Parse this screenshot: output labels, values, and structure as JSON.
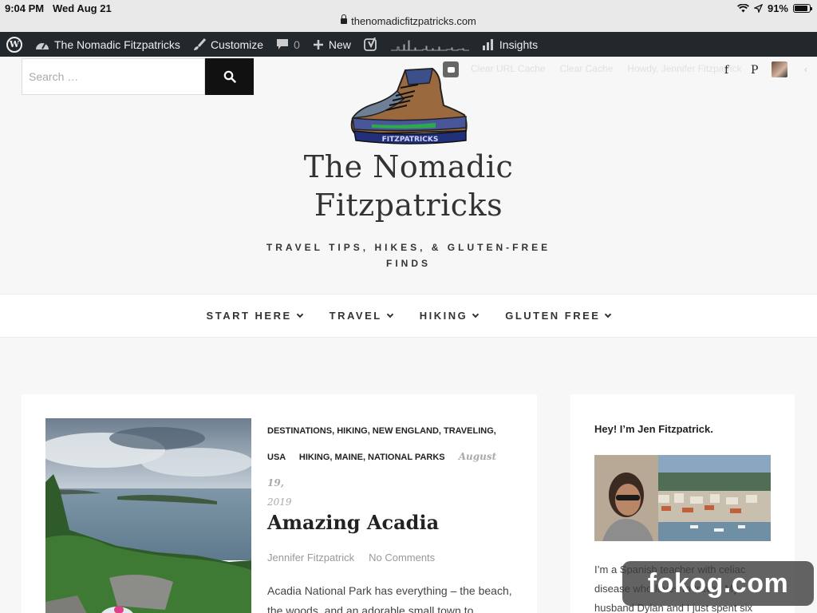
{
  "status_bar": {
    "time": "9:04 PM",
    "date": "Wed Aug 21",
    "url": "thenomadicfitzpatricks.com",
    "battery": "91%",
    "battery_level": 0.91
  },
  "admin_bar": {
    "site_name": "The Nomadic Fitzpatricks",
    "customize": "Customize",
    "comments_count": "0",
    "new": "New",
    "insights": "Insights"
  },
  "header": {
    "search_placeholder": "Search …",
    "ghost_links": [
      "Clear URL Cache",
      "Clear Cache",
      "Howdy, Jennifer Fitzpatrick"
    ],
    "social": {
      "facebook": "f",
      "pinterest": "P"
    },
    "logo_text": "FITZPATRICKS",
    "title_line1": "The Nomadic",
    "title_line2": "Fitzpatricks",
    "tagline_line1": "TRAVEL TIPS, HIKES, & GLUTEN-FREE",
    "tagline_line2": "FINDS"
  },
  "nav": [
    "START HERE",
    "TRAVEL",
    "HIKING",
    "GLUTEN FREE"
  ],
  "post": {
    "categories_line1": "DESTINATIONS, HIKING, NEW ENGLAND, TRAVELING,",
    "categories_line2a": "USA",
    "categories_line2b": "HIKING, MAINE, NATIONAL PARKS",
    "date_part1": "August 19,",
    "date_part2": "2019",
    "title": "Amazing Acadia",
    "author": "Jennifer Fitzpatrick",
    "comments": "No Comments",
    "excerpt": "Acadia National Park has everything – the beach, the woods, and an adorable small town to explore. It’s the perfect summer getaway!"
  },
  "sidebar": {
    "heading": "Hey! I’m Jen Fitzpatrick.",
    "text": "I’m a Spanish teacher with celiac disease who loves to travel. My husband Dylan and I just spent six"
  },
  "watermark": "fokog.com"
}
